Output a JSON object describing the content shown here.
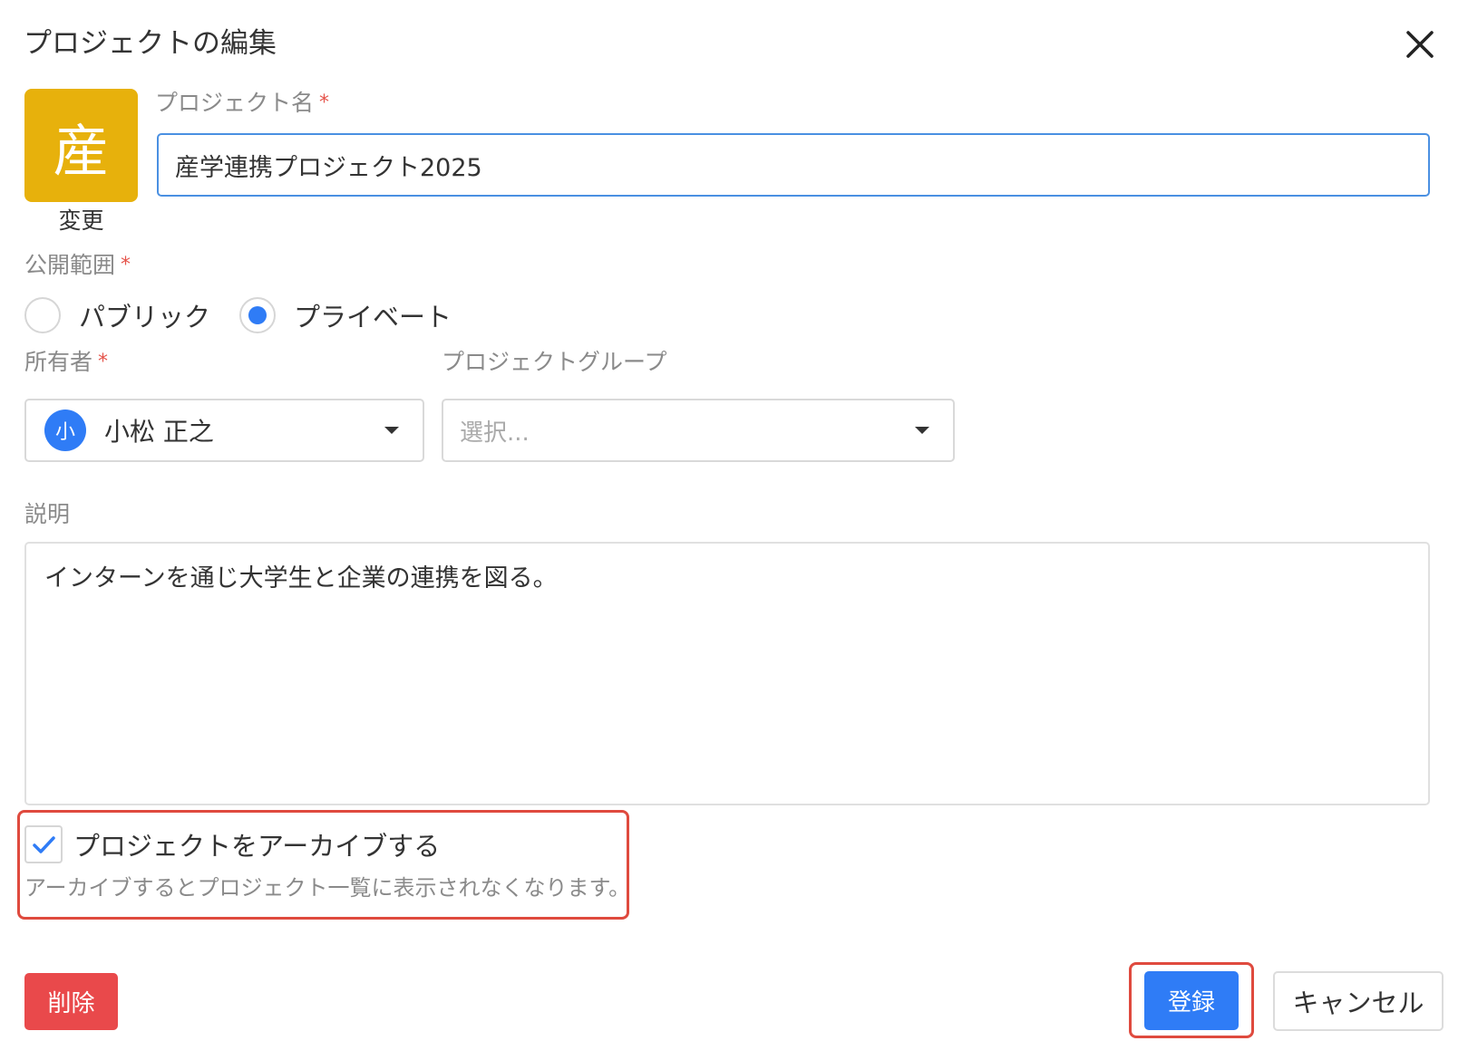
{
  "dialog": {
    "title": "プロジェクトの編集"
  },
  "icon": {
    "char": "産",
    "color": "#e7b10c",
    "change_label": "変更"
  },
  "project_name": {
    "label": "プロジェクト名",
    "required_mark": "*",
    "value": "産学連携プロジェクト2025"
  },
  "visibility": {
    "label": "公開範囲",
    "required_mark": "*",
    "options": [
      {
        "label": "パブリック",
        "selected": false
      },
      {
        "label": "プライベート",
        "selected": true
      }
    ]
  },
  "owner": {
    "label": "所有者",
    "required_mark": "*",
    "avatar_char": "小",
    "value": "小松 正之"
  },
  "project_group": {
    "label": "プロジェクトグループ",
    "placeholder": "選択..."
  },
  "description": {
    "label": "説明",
    "value": "インターンを通じ大学生と企業の連携を図る。"
  },
  "archive": {
    "label": "プロジェクトをアーカイブする",
    "checked": true,
    "help": "アーカイブするとプロジェクト一覧に表示されなくなります。"
  },
  "actions": {
    "delete_label": "削除",
    "register_label": "登録",
    "cancel_label": "キャンセル"
  },
  "colors": {
    "accent": "#2f7cf6",
    "danger": "#e9494b",
    "highlight": "#df4a3e"
  }
}
